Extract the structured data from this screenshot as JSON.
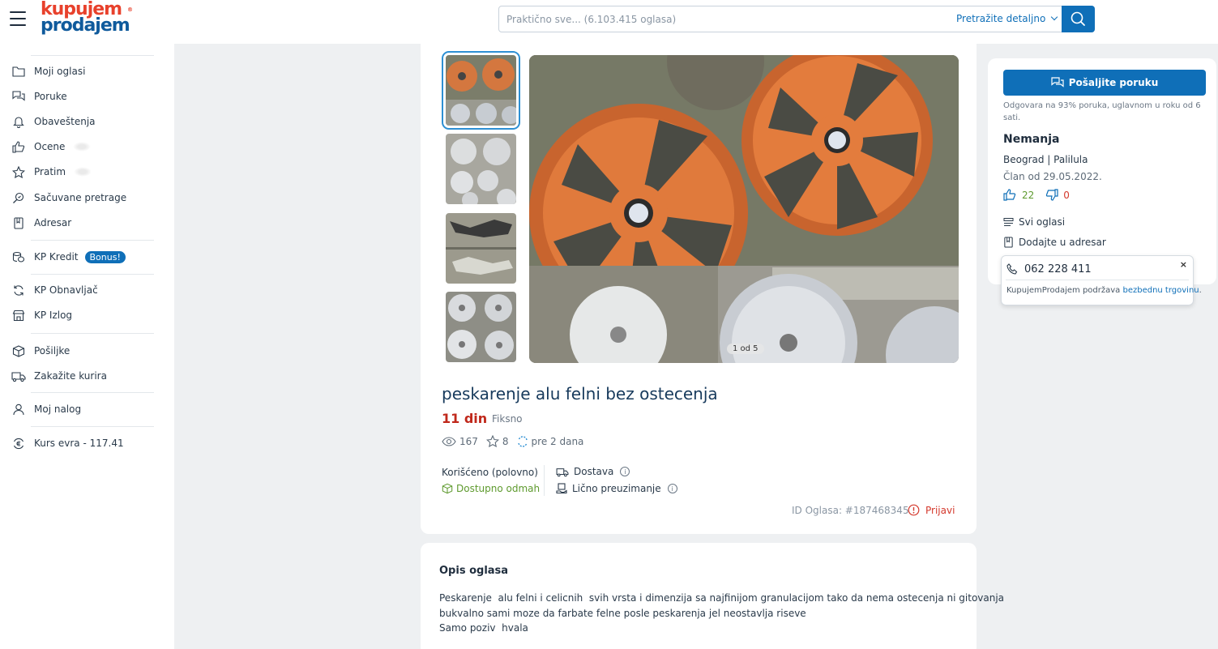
{
  "header": {
    "logo_top": "kupujem",
    "logo_bottom": "prodajem",
    "logo_reg": "®",
    "search_placeholder": "Praktično sve... (6.103.415 oglasa)",
    "detailed_search": "Pretražite detaljno"
  },
  "sidebar": {
    "items": [
      {
        "label": "Moji oglasi",
        "icon": "folder-icon"
      },
      {
        "label": "Poruke",
        "icon": "chat-icon"
      },
      {
        "label": "Obaveštenja",
        "icon": "bell-icon"
      },
      {
        "label": "Ocene",
        "icon": "thumbs-up-icon"
      },
      {
        "label": "Pratim",
        "icon": "star-icon"
      },
      {
        "label": "Sačuvane pretrage",
        "icon": "saved-search-icon"
      },
      {
        "label": "Adresar",
        "icon": "address-book-icon"
      },
      {
        "label": "KP Kredit",
        "icon": "coins-icon",
        "badge": "Bonus!"
      },
      {
        "label": "KP Obnavljač",
        "icon": "refresh-icon"
      },
      {
        "label": "KP Izlog",
        "icon": "storefront-icon"
      },
      {
        "label": "Pošiljke",
        "icon": "package-icon"
      },
      {
        "label": "Zakažite kurira",
        "icon": "truck-icon"
      },
      {
        "label": "Moj nalog",
        "icon": "user-icon"
      },
      {
        "label": "Kurs evra - 117.41",
        "icon": "euro-exchange-icon"
      }
    ]
  },
  "gallery": {
    "counter": "1 od 5"
  },
  "ad": {
    "title": "peskarenje alu felni bez ostecenja",
    "price": "11 din",
    "price_type": "Fiksno",
    "views": "167",
    "favorites": "8",
    "posted": "pre 2 dana",
    "condition": "Korišćeno (polovno)",
    "availability": "Dostupno odmah",
    "delivery": "Dostava",
    "pickup": "Lično preuzimanje",
    "ad_id": "ID Oglasa: #187468345",
    "report": "Prijavi"
  },
  "description": {
    "title": "Opis oglasa",
    "lines": [
      "Peskarenje  alu felni i celicnih  svih vrsta i dimenzija sa najfinijom granulacijom tako da nema ostecenja ni gitovanja",
      "bukvalno sami moze da farbate felne posle peskarenja jel neostavlja riseve",
      "Samo poziv  hvala"
    ]
  },
  "seller": {
    "send_message": "Pošaljite poruku",
    "response_info": "Odgovara na 93% poruka, uglavnom u roku od 6 sati.",
    "name": "Nemanja",
    "location": "Beograd | Palilula",
    "member_since": "Član od 29.05.2022.",
    "positive": "22",
    "negative": "0",
    "all_ads": "Svi oglasi",
    "add_address": "Dodajte u adresar",
    "phone": "062 228 411",
    "safety_note_prefix": "KupujemProdajem podržava ",
    "safety_note_link": "bezbednu trgovinu",
    "safety_note_suffix": ".",
    "close": "×"
  },
  "colors": {
    "brand_blue": "#0f6fb8",
    "logo_red": "#e8412c",
    "price_red": "#c0281b",
    "positive_green": "#5e9a2e",
    "negative_red": "#d4382c"
  }
}
